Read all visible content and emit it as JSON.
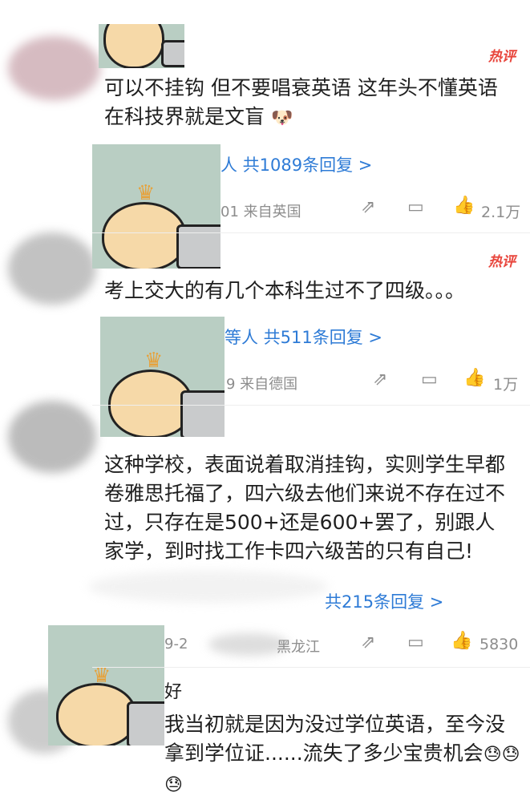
{
  "hot_badge": "热评",
  "comments": [
    {
      "text_line1": "可以不挂钩 但不要唱衰英语 这年头不懂英语",
      "text_line2": "在科技界就是文盲",
      "reply_link": "人 共1089条回复 >",
      "meta": "01 来自英国",
      "likes": "2.1万"
    },
    {
      "text_line1": "考上交大的有几个本科生过不了四级。。。",
      "reply_link": "等人 共511条回复 >",
      "meta": "9 来自德国",
      "likes": "1万"
    },
    {
      "text_line1": "这种学校，表面说着取消挂钩，实则学生早都",
      "text_line2": "卷雅思托福了，四六级去他们来说不存在过不",
      "text_line3": "过，只存在是500+还是600+罢了，别跟人",
      "text_line4": "家学，到时找工作卡四六级苦的只有自己!",
      "reply_link": "共215条回复 >",
      "meta_left": "9-2",
      "meta_right": "黑龙江",
      "likes": "5830"
    },
    {
      "name_fragment": "好",
      "text_line1": "我当初就是因为没过学位英语，至今没",
      "text_line2": "拿到学位证......流失了多少宝贵机会"
    }
  ],
  "icons": {
    "share": "share-icon",
    "comment": "comment-icon",
    "like": "thumbs-up-icon"
  },
  "colors": {
    "link": "#2e7bd6",
    "hot": "#e8453c",
    "meta": "#8d8d8d"
  }
}
